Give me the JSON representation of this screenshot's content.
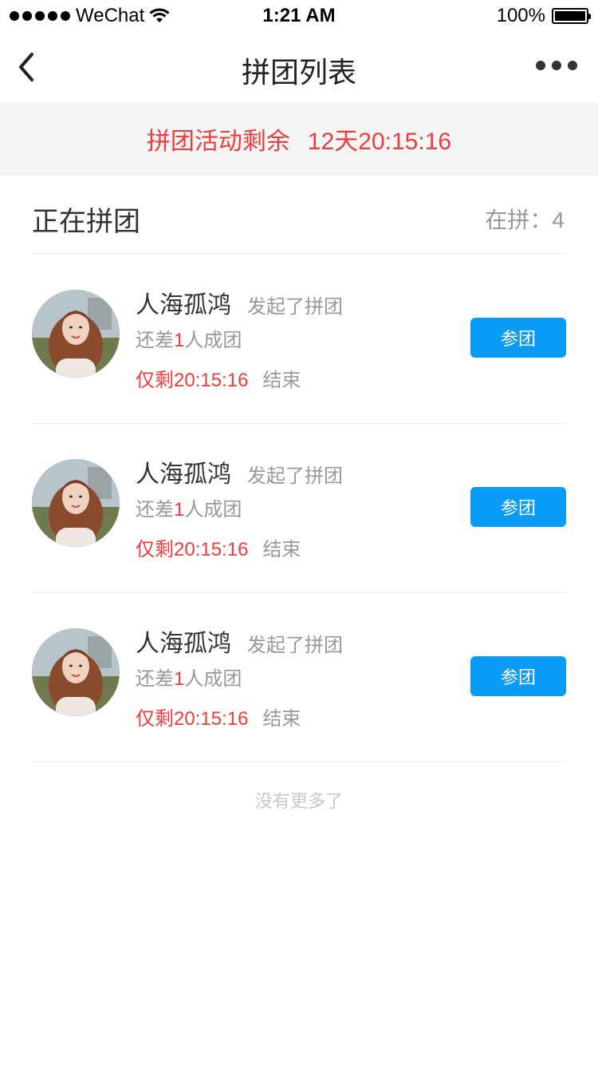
{
  "status_bar": {
    "carrier": "WeChat",
    "time": "1:21 AM",
    "battery": "100%"
  },
  "nav": {
    "title": "拼团列表"
  },
  "banner": {
    "label": "拼团活动剩余",
    "countdown": "12天20:15:16"
  },
  "section": {
    "title": "正在拼团",
    "count_label": "在拼：",
    "count": "4"
  },
  "groups": [
    {
      "name": "人海孤鸿",
      "action": "发起了拼团",
      "need_prefix": "还差",
      "need_num": "1",
      "need_suffix": "人成团",
      "remain": "仅剩20:15:16",
      "end": "结束",
      "button": "参团"
    },
    {
      "name": "人海孤鸿",
      "action": "发起了拼团",
      "need_prefix": "还差",
      "need_num": "1",
      "need_suffix": "人成团",
      "remain": "仅剩20:15:16",
      "end": "结束",
      "button": "参团"
    },
    {
      "name": "人海孤鸿",
      "action": "发起了拼团",
      "need_prefix": "还差",
      "need_num": "1",
      "need_suffix": "人成团",
      "remain": "仅剩20:15:16",
      "end": "结束",
      "button": "参团"
    }
  ],
  "footer": {
    "no_more": "没有更多了"
  },
  "colors": {
    "accent_red": "#f23b3b",
    "button_blue": "#0a9bf5",
    "banner_bg": "#f5f5f5"
  }
}
